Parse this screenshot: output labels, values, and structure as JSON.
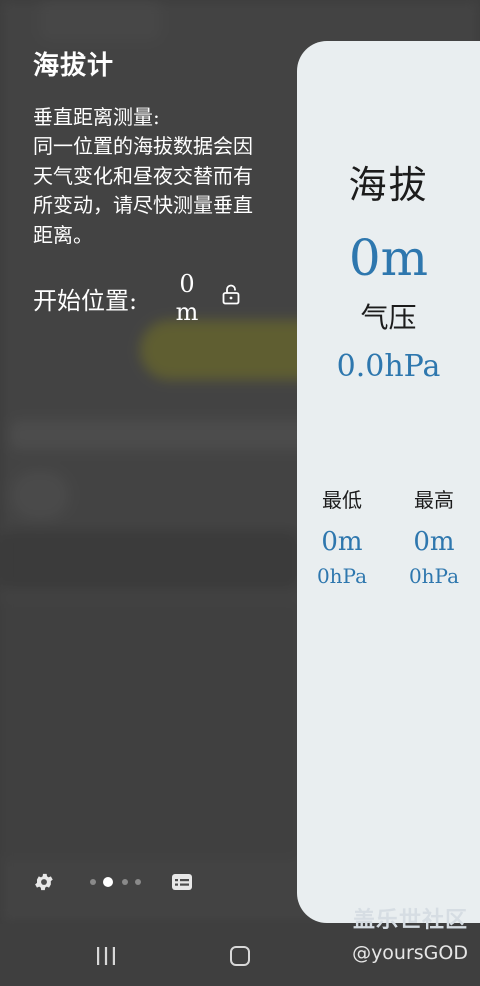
{
  "app": {
    "title": "海拔计"
  },
  "info": {
    "section_label": "垂直距离测量:",
    "description": "同一位置的海拔数据会因天气变化和昼夜交替而有所变动，请尽快测量垂直距离。"
  },
  "start": {
    "label": "开始位置:",
    "value": "0",
    "unit": "m",
    "lock_icon": "unlock-icon"
  },
  "reading": {
    "altitude_label": "海拔",
    "altitude_value": "0m",
    "pressure_label": "气压",
    "pressure_value": "0.0hPa",
    "min": {
      "label": "最低",
      "altitude": "0m",
      "pressure": "0hPa"
    },
    "max": {
      "label": "最高",
      "altitude": "0m",
      "pressure": "0hPa"
    }
  },
  "controls": {
    "settings_icon": "gear-icon",
    "page_count": 4,
    "active_page": 1,
    "card_icon": "card-icon"
  },
  "navbar": {
    "recents_icon": "recents-icon",
    "home_icon": "home-icon"
  },
  "watermark": {
    "brand": "盖乐世社区",
    "user": "@yoursGOD"
  },
  "colors": {
    "accent": "#2e77ae",
    "card_bg": "#e9eef0",
    "overlay_bg": "#4d4d4d"
  }
}
